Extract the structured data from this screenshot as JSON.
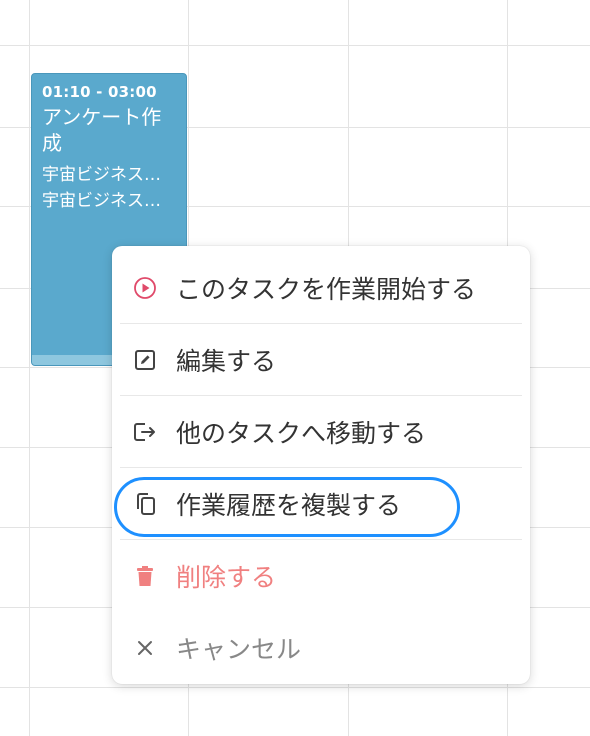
{
  "task_card": {
    "time": "01:10 - 03:00",
    "title": "アンケート作成",
    "subtitle_1": "宇宙ビジネス…",
    "subtitle_2": "宇宙ビジネス…",
    "color": "#5aa9cd"
  },
  "context_menu": {
    "items": [
      {
        "label": "このタスクを作業開始する",
        "icon": "play-circle-icon"
      },
      {
        "label": "編集する",
        "icon": "edit-icon"
      },
      {
        "label": "他のタスクへ移動する",
        "icon": "move-out-icon"
      },
      {
        "label": "作業履歴を複製する",
        "icon": "copy-icon"
      },
      {
        "label": "削除する",
        "icon": "trash-icon"
      },
      {
        "label": "キャンセル",
        "icon": "close-icon"
      }
    ],
    "highlighted_item": "作業履歴を複製する",
    "colors": {
      "play": "#e04a6a",
      "delete": "#f08080",
      "highlight": "#1e90ff"
    }
  }
}
